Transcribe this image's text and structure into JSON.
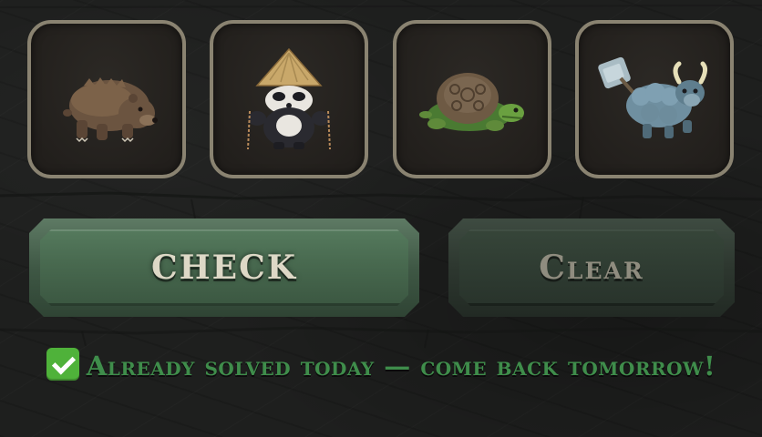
{
  "slots": [
    {
      "icon": "bear-icon",
      "color": "#6b5440"
    },
    {
      "icon": "panda-with-straw-hat-icon",
      "color": "#2a2a30"
    },
    {
      "icon": "turtle-icon",
      "color": "#5f8a3a"
    },
    {
      "icon": "armored-yak-with-hammer-icon",
      "color": "#6f8fa0"
    }
  ],
  "buttons": {
    "check_label": "Check",
    "clear_label": "Clear"
  },
  "status": {
    "icon": "check-mark-icon",
    "text": "Already solved today — come back tomorrow!",
    "color": "#3f8d4b"
  }
}
